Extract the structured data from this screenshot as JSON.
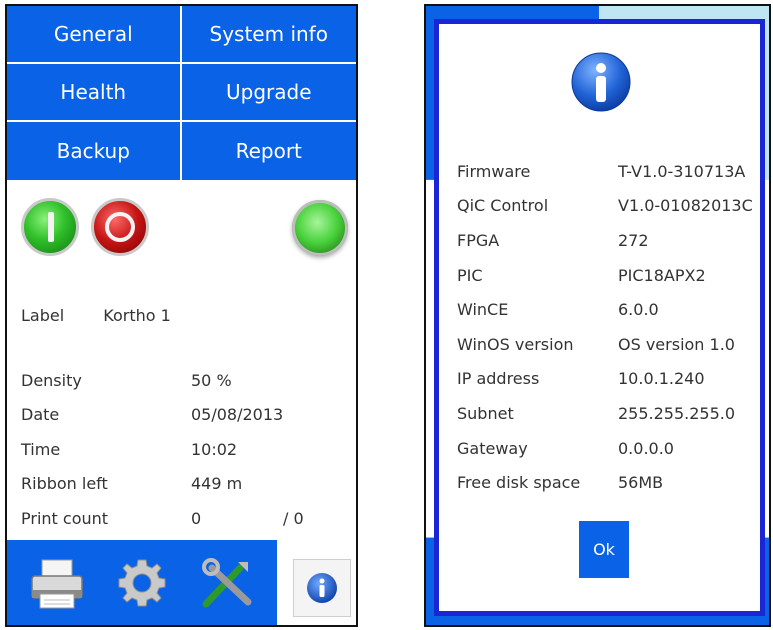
{
  "menu": {
    "general": "General",
    "system_info": "System info",
    "health": "Health",
    "upgrade": "Upgrade",
    "backup": "Backup",
    "report": "Report"
  },
  "label_row": {
    "key": "Label",
    "value": "Kortho 1"
  },
  "status": [
    {
      "key": "Density",
      "value": "50 %",
      "extra": ""
    },
    {
      "key": "Date",
      "value": "05/08/2013",
      "extra": ""
    },
    {
      "key": "Time",
      "value": "10:02",
      "extra": ""
    },
    {
      "key": "Ribbon left",
      "value": "449 m",
      "extra": ""
    },
    {
      "key": "Print count",
      "value": "0",
      "extra": "/ 0"
    }
  ],
  "bottom_icons": [
    "printer-icon",
    "gear-icon",
    "tools-icon",
    "info-icon"
  ],
  "dialog": {
    "rows": [
      {
        "key": "Firmware",
        "value": "T-V1.0-310713A"
      },
      {
        "key": "QiC Control",
        "value": "V1.0-01082013C"
      },
      {
        "key": "FPGA",
        "value": "272"
      },
      {
        "key": "PIC",
        "value": "PIC18APX2"
      },
      {
        "key": "WinCE",
        "value": "6.0.0"
      },
      {
        "key": "WinOS version",
        "value": "OS version 1.0"
      },
      {
        "key": "IP address",
        "value": "10.0.1.240"
      },
      {
        "key": "Subnet",
        "value": "255.255.255.0"
      },
      {
        "key": "Gateway",
        "value": "0.0.0.0"
      },
      {
        "key": "Free disk space",
        "value": "56MB"
      }
    ],
    "ok_label": "Ok"
  },
  "colors": {
    "accent_blue": "#0a62e6",
    "dialog_border": "#1a26d6",
    "start_green": "#2fbf2a",
    "stop_red": "#c41414"
  }
}
